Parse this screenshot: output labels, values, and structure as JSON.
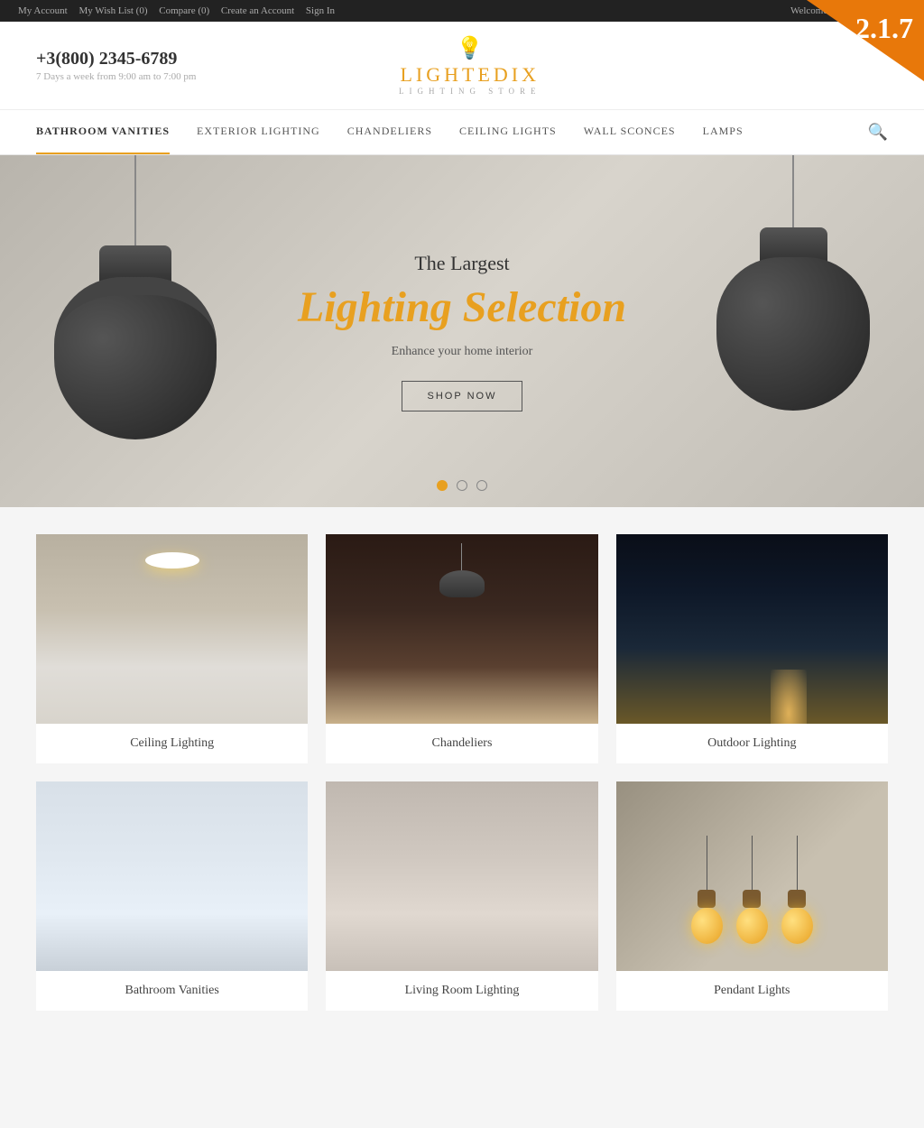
{
  "topbar": {
    "links": [
      "My Account",
      "My Wish List (0)",
      "Compare (0)",
      "Create an Account",
      "Sign In"
    ],
    "welcome": "Welcome to our online store!"
  },
  "version": "2.1.7",
  "header": {
    "phone": "+3(800) 2345-6789",
    "hours": "7 Days a week from 9:00 am to 7:00 pm",
    "logo_name_1": "LIGHTE",
    "logo_name_2": "DIX",
    "logo_sub": "LIGHTING STORE"
  },
  "nav": {
    "items": [
      {
        "label": "BATHROOM VANITIES",
        "active": true
      },
      {
        "label": "EXTERIOR LIGHTING",
        "active": false
      },
      {
        "label": "CHANDELIERS",
        "active": false
      },
      {
        "label": "CEILING LIGHTS",
        "active": false
      },
      {
        "label": "WALL SCONCES",
        "active": false
      },
      {
        "label": "LAMPS",
        "active": false
      }
    ]
  },
  "hero": {
    "subtitle": "The Largest",
    "title": "Lighting Selection",
    "description": "Enhance your home interior",
    "button": "SHOP NOW",
    "dots": [
      true,
      false,
      false
    ]
  },
  "products": {
    "row1": [
      {
        "label": "Ceiling Lighting"
      },
      {
        "label": "Chandeliers"
      },
      {
        "label": "Outdoor Lighting"
      }
    ],
    "row2": [
      {
        "label": "Bathroom Vanities"
      },
      {
        "label": "Living Room Lighting"
      },
      {
        "label": "Pendant Lights"
      }
    ]
  }
}
